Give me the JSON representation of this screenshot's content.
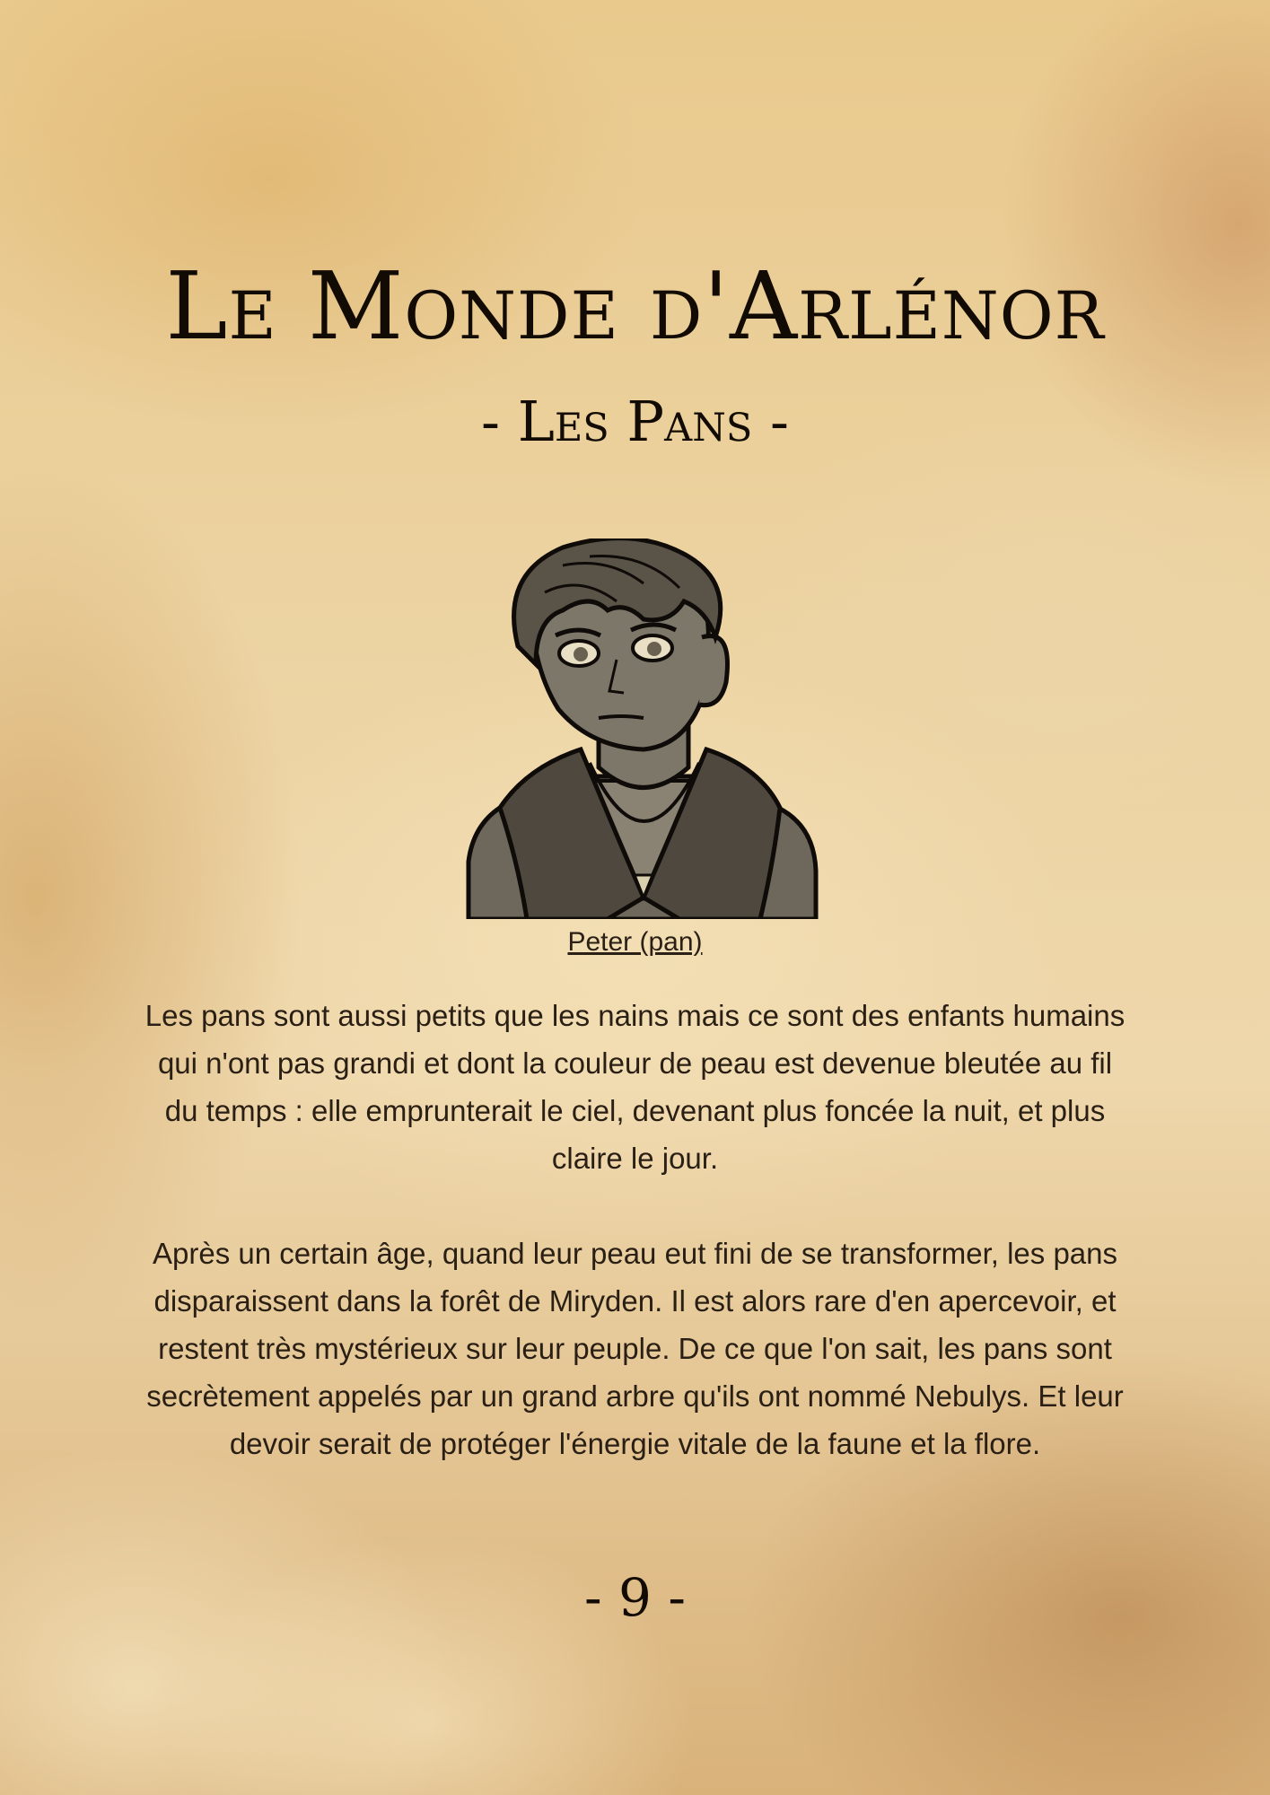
{
  "page": {
    "title": "Le Monde d'Arlénor",
    "subtitle": "- Les Pans -",
    "caption": "Peter (pan)",
    "paragraphs": [
      "Les pans sont aussi petits que les nains mais ce sont des enfants humains qui n'ont pas grandi et dont la couleur de peau est devenue bleutée au fil du temps : elle emprunterait le ciel, devenant plus foncée la nuit, et plus claire le jour.",
      "Après un certain âge, quand leur peau eut fini de se transformer, les pans disparaissent dans la forêt de Miryden. Il est alors rare d'en apercevoir, et restent très mystérieux sur leur peuple. De ce que l'on sait, les pans sont secrètement appelés par un grand arbre qu'ils ont nommé Nebulys. Et leur devoir serait de protéger l'énergie vitale de la faune et la flore."
    ],
    "page_number": "- 9 -"
  },
  "colors": {
    "parchment": "#ecd3a2",
    "ink": "#120b04",
    "illustration_fill": "#6b6457"
  },
  "illustration": {
    "subject": "pan-character-portrait"
  }
}
